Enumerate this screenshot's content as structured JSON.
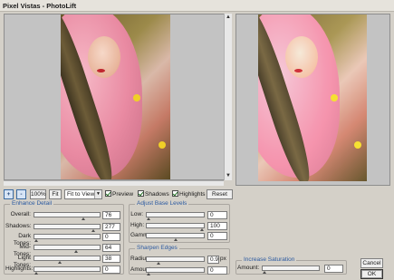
{
  "window": {
    "title": "Pixel Vistas - PhotoLift"
  },
  "toolbar": {
    "zoom_in": "+",
    "zoom_out": "-",
    "zoom_100": "100%",
    "fit": "Fit",
    "fit_select": "Fit to View",
    "preview": {
      "label": "Preview",
      "checked": true
    },
    "shadows": {
      "label": "Shadows",
      "checked": true
    },
    "highlights": {
      "label": "Highlights",
      "checked": true
    },
    "reset": "Reset"
  },
  "enhance_detail": {
    "title": "Enhance Detail",
    "rows": [
      {
        "label": "Overall:",
        "value": "76",
        "level": 0.76
      },
      {
        "label": "Shadows:",
        "value": "277",
        "level": 0.92
      },
      {
        "label": "Dark Tones:",
        "value": "0",
        "level": 0.0
      },
      {
        "label": "Mid-Tones:",
        "value": "64",
        "level": 0.64
      },
      {
        "label": "Light Tones:",
        "value": "38",
        "level": 0.38
      },
      {
        "label": "Highlights:",
        "value": "0",
        "level": 0.0
      }
    ]
  },
  "adjust_base_levels": {
    "title": "Adjust Base Levels",
    "rows": [
      {
        "label": "Low:",
        "value": "0",
        "level": 0.0
      },
      {
        "label": "High:",
        "value": "100",
        "level": 1.0
      },
      {
        "label": "Gamma:",
        "value": "0",
        "level": 0.5
      }
    ]
  },
  "sharpen_edges": {
    "title": "Sharpen Edges",
    "rows": [
      {
        "label": "Radius:",
        "value": "0.9",
        "unit": "px",
        "level": 0.18
      },
      {
        "label": "Amount:",
        "value": "0",
        "level": 0.0
      }
    ]
  },
  "increase_saturation": {
    "title": "Increase Saturation",
    "rows": [
      {
        "label": "Amount:",
        "value": "0",
        "level": 0.0
      }
    ]
  },
  "buttons": {
    "cancel": "Cancel",
    "ok": "OK"
  },
  "scrollbar": {
    "up": "▲",
    "down": "▼"
  }
}
